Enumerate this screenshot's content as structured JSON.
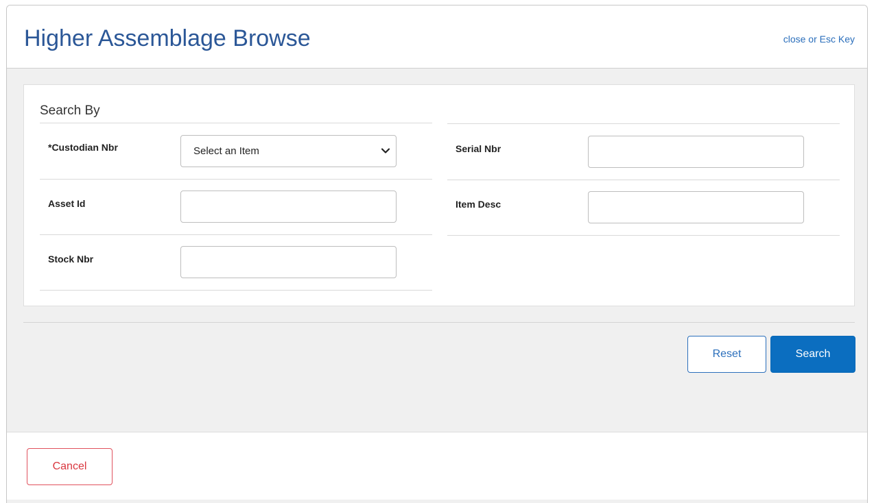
{
  "modal": {
    "title": "Higher Assemblage Browse",
    "close_label": "close or Esc Key"
  },
  "search": {
    "section_title": "Search By",
    "fields": {
      "custodian_nbr": {
        "label": "*Custodian Nbr",
        "value": "Select an Item"
      },
      "asset_id": {
        "label": "Asset Id",
        "value": ""
      },
      "stock_nbr": {
        "label": "Stock Nbr",
        "value": ""
      },
      "serial_nbr": {
        "label": "Serial Nbr",
        "value": ""
      },
      "item_desc": {
        "label": "Item Desc",
        "value": ""
      }
    }
  },
  "actions": {
    "reset_label": "Reset",
    "search_label": "Search",
    "cancel_label": "Cancel"
  },
  "icons": {
    "select_chevron": "chevron-down-icon"
  },
  "colors": {
    "title": "#2b5797",
    "link": "#2a6ebb",
    "primary": "#0b6ec0",
    "danger": "#d9363e",
    "body_bg": "#f0f0f0"
  }
}
